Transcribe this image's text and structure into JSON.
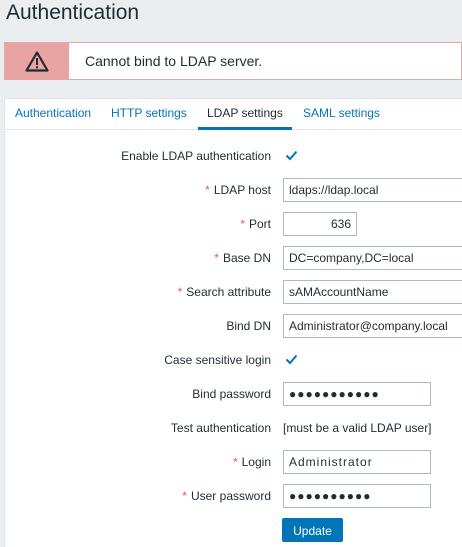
{
  "page": {
    "title": "Authentication"
  },
  "alert": {
    "message": "Cannot bind to LDAP server."
  },
  "tabs": [
    {
      "label": "Authentication"
    },
    {
      "label": "HTTP settings"
    },
    {
      "label": "LDAP settings",
      "active": true
    },
    {
      "label": "SAML settings"
    }
  ],
  "form": {
    "enable_ldap": {
      "label": "Enable LDAP authentication",
      "checked": true
    },
    "ldap_host": {
      "label": "LDAP host",
      "value": "ldaps://ldap.local"
    },
    "port": {
      "label": "Port",
      "value": "636"
    },
    "base_dn": {
      "label": "Base DN",
      "value": "DC=company,DC=local"
    },
    "search_attribute": {
      "label": "Search attribute",
      "value": "sAMAccountName"
    },
    "bind_dn": {
      "label": "Bind DN",
      "value": "Administrator@company.local"
    },
    "case_sensitive": {
      "label": "Case sensitive login",
      "checked": true
    },
    "bind_password": {
      "label": "Bind password",
      "value": "●●●●●●●●●●●"
    },
    "test_auth": {
      "label": "Test authentication",
      "hint": "[must be a valid LDAP user]"
    },
    "login": {
      "label": "Login",
      "value": "Administrator"
    },
    "user_password": {
      "label": "User password",
      "value": "●●●●●●●●●●"
    },
    "required_marker": "*"
  },
  "actions": {
    "update_label": "Update"
  },
  "colors": {
    "accent": "#0275b8",
    "required": "#e45959",
    "alert_bg": "#e8a3a3"
  }
}
